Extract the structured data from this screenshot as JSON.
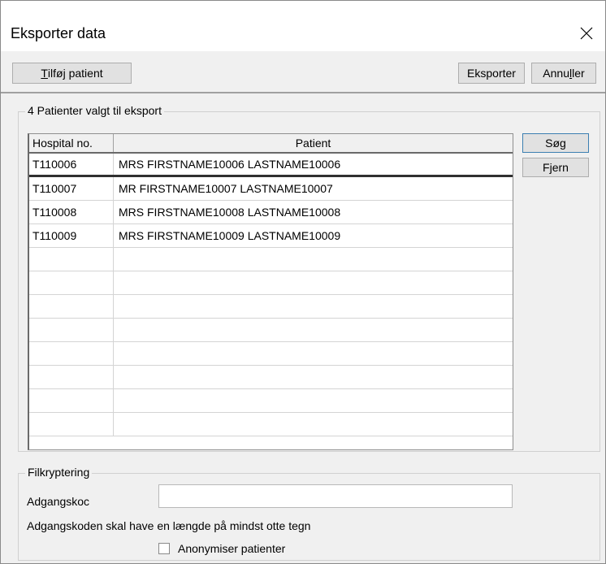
{
  "window": {
    "title": "Eksporter data",
    "close_icon": "close-icon"
  },
  "toolbar": {
    "add_patient_underlined": "T",
    "add_patient_rest": "ilføj patient",
    "export_label": "Eksporter",
    "cancel_label_before": "Annu",
    "cancel_label_underlined": "l",
    "cancel_label_after": "ler"
  },
  "patients_group": {
    "label": "4 Patienter valgt til eksport",
    "columns": [
      "Hospital no.",
      "Patient"
    ],
    "rows": [
      {
        "hospital_no": "T110006",
        "patient": "MRS FIRSTNAME10006 LASTNAME10006",
        "selected": true
      },
      {
        "hospital_no": "T110007",
        "patient": "MR FIRSTNAME10007 LASTNAME10007",
        "selected": false
      },
      {
        "hospital_no": "T110008",
        "patient": "MRS FIRSTNAME10008 LASTNAME10008",
        "selected": false
      },
      {
        "hospital_no": "T110009",
        "patient": "MRS FIRSTNAME10009 LASTNAME10009",
        "selected": false
      }
    ],
    "search_label": "Søg",
    "remove_label": "Fjern"
  },
  "encryption_group": {
    "label": "Filkryptering",
    "password_label": "Adgangskoc",
    "password_value": "",
    "hint": "Adgangskoden skal have en længde på mindst otte tegn",
    "anonymize_label": "Anonymiser patienter",
    "anonymize_checked": false
  }
}
